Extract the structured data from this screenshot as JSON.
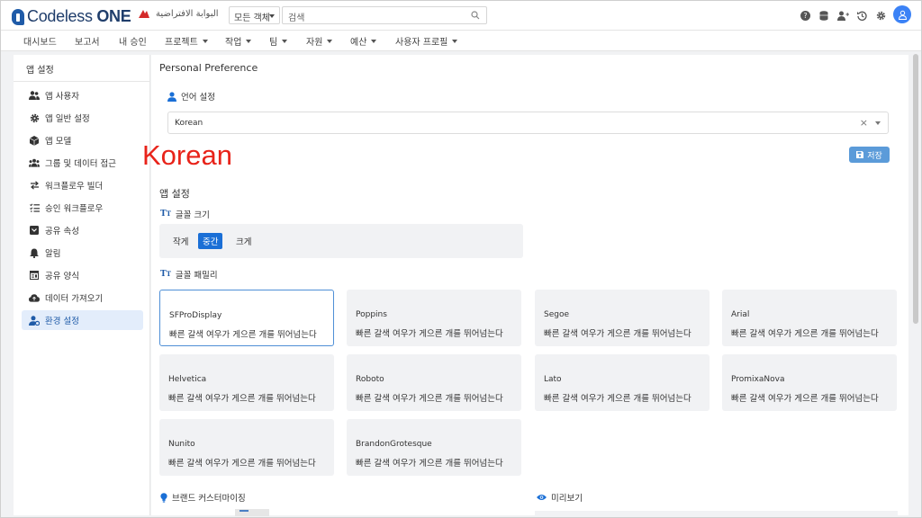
{
  "header": {
    "logo_text_regular": "Codeless ",
    "logo_text_bold": "ONE",
    "portal_label": "البوابة الافتراضية",
    "scope_selector": "모든 객체",
    "search_placeholder": "검색"
  },
  "nav": {
    "items": [
      {
        "label": "대시보드",
        "has_dropdown": false
      },
      {
        "label": "보고서",
        "has_dropdown": false
      },
      {
        "label": "내 승인",
        "has_dropdown": false
      },
      {
        "label": "프로젝트",
        "has_dropdown": true
      },
      {
        "label": "작업",
        "has_dropdown": true
      },
      {
        "label": "팀",
        "has_dropdown": true
      },
      {
        "label": "자원",
        "has_dropdown": true
      },
      {
        "label": "예산",
        "has_dropdown": true
      },
      {
        "label": "사용자 프로필",
        "has_dropdown": true
      }
    ]
  },
  "sidebar": {
    "title": "앱 설정",
    "items": [
      {
        "label": "앱 사용자",
        "icon": "users-icon"
      },
      {
        "label": "앱 일반 설정",
        "icon": "gear-icon"
      },
      {
        "label": "앱 모델",
        "icon": "cube-icon"
      },
      {
        "label": "그룹 및 데이터 접근",
        "icon": "group-icon"
      },
      {
        "label": "워크플로우 빌더",
        "icon": "swap-icon"
      },
      {
        "label": "승인 워크플로우",
        "icon": "checklist-icon"
      },
      {
        "label": "공유 속성",
        "icon": "inbox-icon"
      },
      {
        "label": "알림",
        "icon": "bell-icon"
      },
      {
        "label": "공유 양식",
        "icon": "form-icon"
      },
      {
        "label": "데이터 가져오기",
        "icon": "cloud-upload-icon"
      },
      {
        "label": "환경 설정",
        "icon": "user-settings-icon",
        "active": true
      }
    ]
  },
  "main": {
    "title": "Personal Preference",
    "language_label": "언어 설정",
    "language_value": "Korean",
    "save_label": "저장",
    "annotation": "Korean",
    "app_settings_title": "앱 설정",
    "font_size_label": "글꼴 크기",
    "font_sizes": [
      {
        "label": "작게",
        "selected": false
      },
      {
        "label": "중간",
        "selected": true
      },
      {
        "label": "크게",
        "selected": false
      }
    ],
    "font_family_label": "글꼴 패밀리",
    "fonts": [
      {
        "name": "SFProDisplay",
        "sample": "빠른 갈색 여우가 게으른 개를 뛰어넘는다",
        "selected": true
      },
      {
        "name": "Poppins",
        "sample": "빠른 갈색 여우가 게으른 개를 뛰어넘는다",
        "selected": false
      },
      {
        "name": "Segoe",
        "sample": "빠른 갈색 여우가 게으른 개를 뛰어넘는다",
        "selected": false
      },
      {
        "name": "Arial",
        "sample": "빠른 갈색 여우가 게으른 개를 뛰어넘는다",
        "selected": false
      },
      {
        "name": "Helvetica",
        "sample": "빠른 갈색 여우가 게으른 개를 뛰어넘는다",
        "selected": false
      },
      {
        "name": "Roboto",
        "sample": "빠른 갈색 여우가 게으른 개를 뛰어넘는다",
        "selected": false
      },
      {
        "name": "Lato",
        "sample": "빠른 갈색 여우가 게으른 개를 뛰어넘는다",
        "selected": false
      },
      {
        "name": "PromixaNova",
        "sample": "빠른 갈색 여우가 게으른 개를 뛰어넘는다",
        "selected": false
      },
      {
        "name": "Nunito",
        "sample": "빠른 갈색 여우가 게으른 개를 뛰어넘는다",
        "selected": false
      },
      {
        "name": "BrandonGrotesque",
        "sample": "빠른 갈색 여우가 게으른 개를 뛰어넘는다",
        "selected": false
      }
    ],
    "brand_label": "브랜드 커스터마이징",
    "preview_label": "미리보기"
  },
  "colors": {
    "accent": "#1a6fd6",
    "brand": "#1f3d6b",
    "annotation": "#e8231a"
  }
}
